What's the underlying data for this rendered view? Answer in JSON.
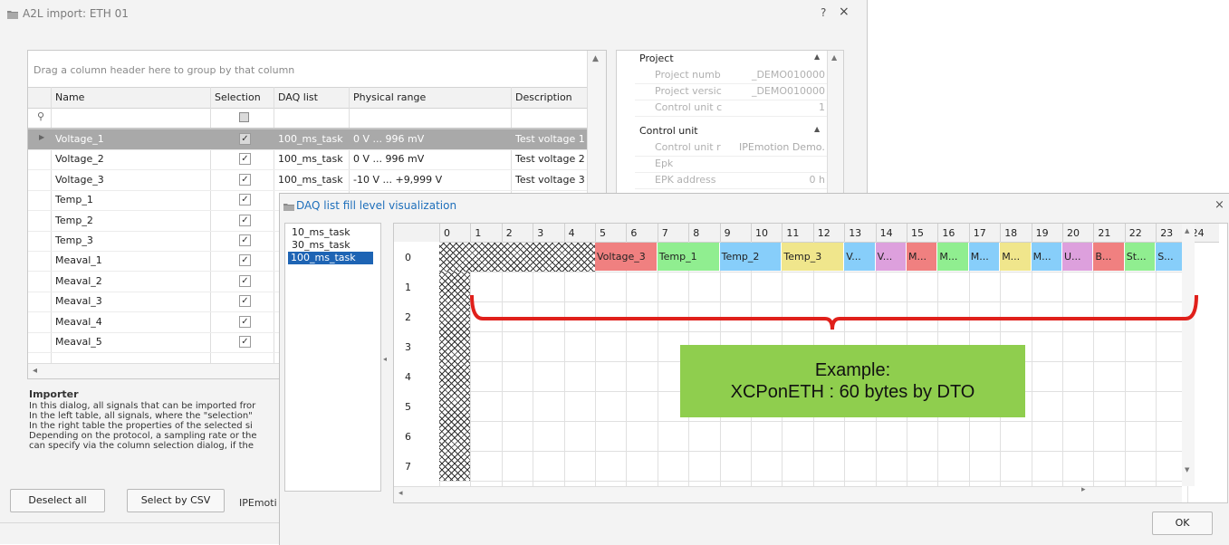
{
  "window": {
    "title": "A2L import: ETH 01",
    "help": "?",
    "close": "×"
  },
  "grid": {
    "group_hint": "Drag a column header here to group by that column",
    "columns": [
      "Name",
      "Selection",
      "DAQ list",
      "Physical range",
      "Description"
    ],
    "rows": [
      {
        "name": "Voltage_1",
        "checked": "✓",
        "daq": "100_ms_task",
        "range": "0 V ... 996 mV",
        "desc": "Test voltage 1"
      },
      {
        "name": "Voltage_2",
        "checked": "✓",
        "daq": "100_ms_task",
        "range": "0 V ... 996 mV",
        "desc": "Test voltage 2"
      },
      {
        "name": "Voltage_3",
        "checked": "✓",
        "daq": "100_ms_task",
        "range": "-10 V ... +9,999 V",
        "desc": "Test voltage 3"
      },
      {
        "name": "Temp_1",
        "checked": "✓",
        "daq": "",
        "range": "",
        "desc": ""
      },
      {
        "name": "Temp_2",
        "checked": "✓",
        "daq": "",
        "range": "",
        "desc": ""
      },
      {
        "name": "Temp_3",
        "checked": "✓",
        "daq": "",
        "range": "",
        "desc": ""
      },
      {
        "name": "Meaval_1",
        "checked": "✓",
        "daq": "",
        "range": "",
        "desc": ""
      },
      {
        "name": "Meaval_2",
        "checked": "✓",
        "daq": "",
        "range": "",
        "desc": ""
      },
      {
        "name": "Meaval_3",
        "checked": "✓",
        "daq": "",
        "range": "",
        "desc": ""
      },
      {
        "name": "Meaval_4",
        "checked": "✓",
        "daq": "",
        "range": "",
        "desc": ""
      },
      {
        "name": "Meaval_5",
        "checked": "✓",
        "daq": "",
        "range": "",
        "desc": ""
      }
    ]
  },
  "properties": {
    "project": {
      "label": "Project",
      "items": [
        {
          "key": "Project numb",
          "value": "_DEMO010000"
        },
        {
          "key": "Project versic",
          "value": "_DEMO010000"
        },
        {
          "key": "Control unit c",
          "value": "1"
        }
      ]
    },
    "control_unit": {
      "label": "Control unit",
      "items": [
        {
          "key": "Control unit r",
          "value": "IPEmotion Demo..."
        },
        {
          "key": "Epk",
          "value": ""
        },
        {
          "key": "EPK address",
          "value": "0 h"
        }
      ]
    }
  },
  "importer": {
    "title": "Importer",
    "lines": [
      "In this dialog, all signals that can be imported fror",
      "In the left table, all signals, where the \"selection\"",
      "In the right table the properties of the selected si",
      "Depending on the protocol, a sampling rate or the",
      "can specify via the column selection dialog, if the"
    ]
  },
  "buttons": {
    "deselect_all": "Deselect all",
    "select_by_csv": "Select by CSV",
    "ipemoti": "IPEmoti",
    "ok": "OK"
  },
  "daq_dialog": {
    "title": "DAQ list fill level visualization",
    "close": "×",
    "tasks": [
      "10_ms_task",
      "30_ms_task",
      "100_ms_task"
    ],
    "selected_task": "100_ms_task",
    "byte_columns": [
      "0",
      "1",
      "2",
      "3",
      "4",
      "5",
      "6",
      "7",
      "8",
      "9",
      "10",
      "11",
      "12",
      "13",
      "14",
      "15",
      "16",
      "17",
      "18",
      "19",
      "20",
      "21",
      "22",
      "23",
      "24"
    ],
    "odt_rows": [
      "0",
      "1",
      "2",
      "3",
      "4",
      "5",
      "6",
      "7"
    ],
    "signals_row0": [
      {
        "label": "Voltage_3",
        "start": 5,
        "span": 2,
        "color": "#f08080"
      },
      {
        "label": "Temp_1",
        "start": 7,
        "span": 2,
        "color": "#90ee90"
      },
      {
        "label": "Temp_2",
        "start": 9,
        "span": 2,
        "color": "#87cefa"
      },
      {
        "label": "Temp_3",
        "start": 11,
        "span": 2,
        "color": "#f0e68c"
      },
      {
        "label": "V...",
        "start": 13,
        "span": 1,
        "color": "#87cefa"
      },
      {
        "label": "V...",
        "start": 14,
        "span": 1,
        "color": "#dda0dd"
      },
      {
        "label": "M...",
        "start": 15,
        "span": 1,
        "color": "#f08080"
      },
      {
        "label": "M...",
        "start": 16,
        "span": 1,
        "color": "#90ee90"
      },
      {
        "label": "M...",
        "start": 17,
        "span": 1,
        "color": "#87cefa"
      },
      {
        "label": "M...",
        "start": 18,
        "span": 1,
        "color": "#f0e68c"
      },
      {
        "label": "M...",
        "start": 19,
        "span": 1,
        "color": "#87cefa"
      },
      {
        "label": "U...",
        "start": 20,
        "span": 1,
        "color": "#dda0dd"
      },
      {
        "label": "B...",
        "start": 21,
        "span": 1,
        "color": "#f08080"
      },
      {
        "label": "St...",
        "start": 22,
        "span": 1,
        "color": "#90ee90"
      },
      {
        "label": "S...",
        "start": 23,
        "span": 1,
        "color": "#87cefa"
      }
    ]
  },
  "annotation": {
    "line1": "Example:",
    "line2": "XCPonETH : 60 bytes by DTO",
    "brace_color": "#e0201b",
    "box_color": "#8fce4e"
  }
}
